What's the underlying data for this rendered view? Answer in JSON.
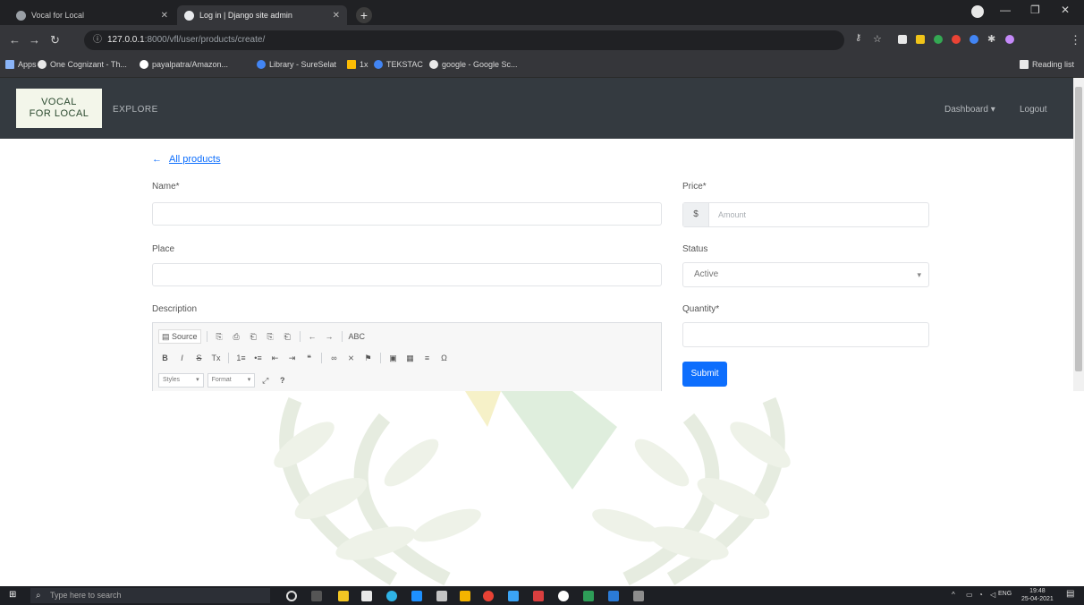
{
  "browser": {
    "tabs": [
      {
        "title": "Vocal for Local"
      },
      {
        "title": "Log in | Django site admin"
      }
    ],
    "new_tab_symbol": "+",
    "url_host": "127.0.0.1",
    "url_path": ":8000/vfl/user/products/create/",
    "bookmarks": [
      "Apps",
      "One Cognizant - Th...",
      "payalpatra/Amazon...",
      "Library - SureSelat",
      "1x",
      "TEKSTAC",
      "google - Google Sc..."
    ],
    "reading_list": "Reading list",
    "window_controls": [
      "—",
      "❐",
      "✕"
    ]
  },
  "site": {
    "logo_line1": "VOCAL",
    "logo_line2": "FOR LOCAL",
    "nav_explore": "EXPLORE",
    "nav_dashboard": "Dashboard ▾",
    "nav_logout": "Logout"
  },
  "form": {
    "back_arrow": "←",
    "back_label": "All products",
    "name_label": "Name*",
    "place_label": "Place",
    "description_label": "Description",
    "price_label": "Price*",
    "price_prefix": "$",
    "price_placeholder": "Amount",
    "status_label": "Status",
    "status_value": "Active",
    "quantity_label": "Quantity*",
    "submit_label": "Submit"
  },
  "editor": {
    "row1": [
      "Source",
      "⎘",
      "⎙",
      "⎗",
      "⎘",
      "⎗",
      "←",
      "→",
      "ABC"
    ],
    "row2": [
      "B",
      "I",
      "S",
      "Tx",
      "1≡",
      "•≡",
      "⇤",
      "⇥",
      "❝",
      "∞",
      "⨯",
      "⚑",
      "▣",
      "▦",
      "≡",
      "Ω"
    ],
    "styles_label": "Styles",
    "format_label": "Format",
    "row3_extra": [
      "⤢",
      "?"
    ]
  },
  "taskbar": {
    "search_placeholder": "Type here to search",
    "time": "19:48",
    "date": "25-04-2021",
    "lang": "ENG"
  },
  "colors": {
    "chrome_dark": "#202124",
    "navbar": "#343a40",
    "primary": "#0d6efd",
    "watermark_green": "#dfe8d6",
    "watermark_gold": "#f6f1c8"
  }
}
